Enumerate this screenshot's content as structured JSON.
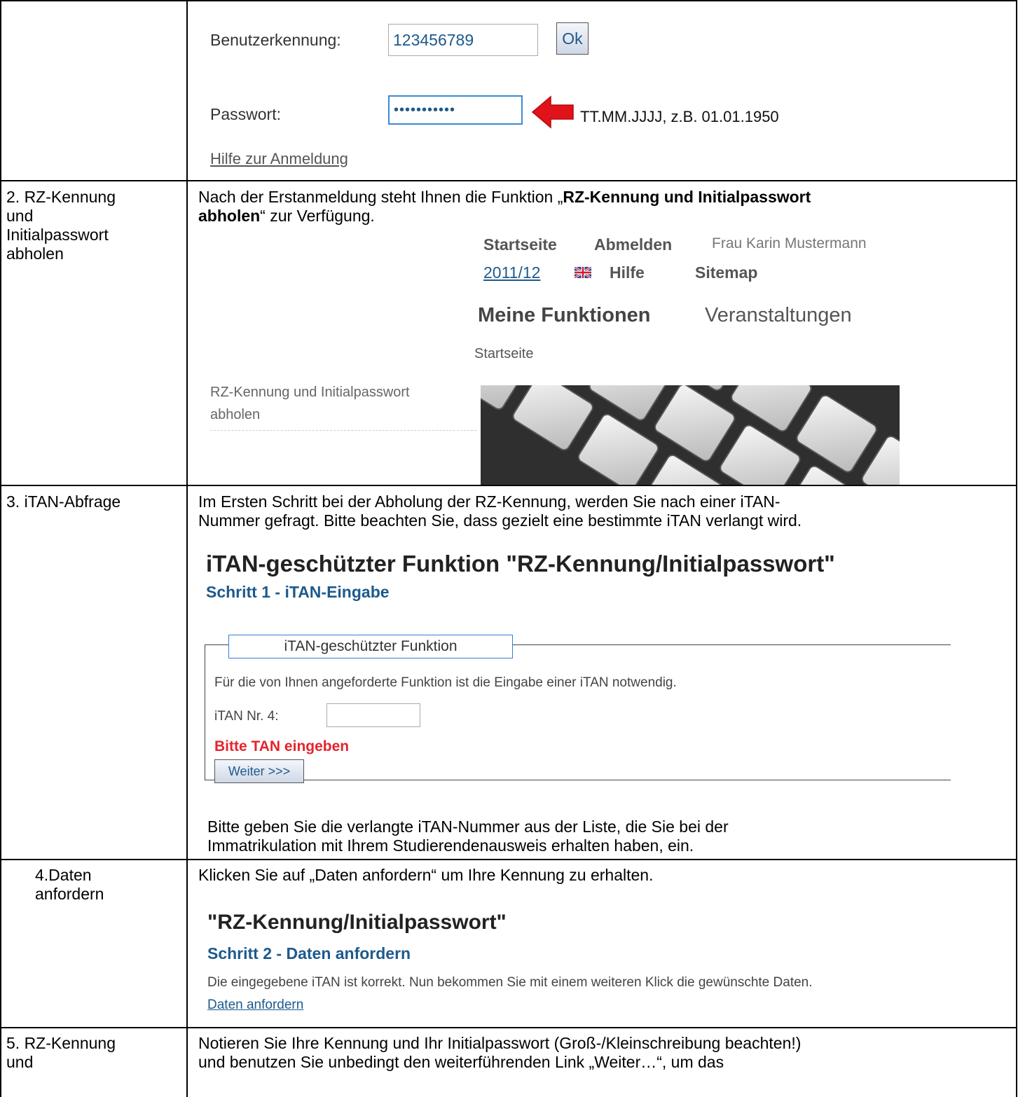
{
  "login": {
    "user_label": "Benutzerkennung:",
    "user_value": "123456789",
    "ok_label": "Ok",
    "password_label": "Passwort:",
    "password_value": "•••••••••••",
    "hint": "TT.MM.JJJJ, z.B. 01.01.1950",
    "help_link": "Hilfe zur Anmeldung"
  },
  "rows": [
    {
      "label_lines": [
        "2. RZ-Kennung",
        "und",
        "Initialpasswort",
        "abholen"
      ],
      "text_pre": "Nach der Erstanmeldung steht Ihnen die Funktion „",
      "text_bold_1": "RZ-Kennung und Initialpasswort",
      "text_bold_2": "abholen",
      "text_post": "“ zur Verfügung."
    },
    {
      "label": "3. iTAN-Abfrage",
      "text_line1": "Im Ersten Schritt bei der Abholung der RZ-Kennung, werden Sie nach einer iTAN-",
      "text_line2": "Nummer gefragt. Bitte beachten Sie, dass gezielt eine bestimmte iTAN verlangt wird.",
      "after_line1": "Bitte geben Sie die verlangte iTAN-Nummer aus der Liste, die Sie bei der",
      "after_line2": "Immatrikulation mit Ihrem Studierendenausweis erhalten haben, ein."
    },
    {
      "label_lines": [
        "4.Daten",
        "anfordern"
      ],
      "text": "Klicken Sie auf „Daten anfordern“ um Ihre Kennung zu erhalten."
    },
    {
      "label_lines": [
        "5. RZ-Kennung",
        "und"
      ],
      "text_line1": "Notieren Sie Ihre Kennung und Ihr Initialpasswort (Groß-/Kleinschreibung beachten!)",
      "text_line2": "und benutzen Sie unbedingt den weiterführenden Link „Weiter…“, um das"
    }
  ],
  "portal": {
    "nav_start": "Startseite",
    "nav_logout": "Abmelden",
    "user_name": "Frau Karin Mustermann",
    "semester": "2011/12",
    "nav_help": "Hilfe",
    "nav_sitemap": "Sitemap",
    "tab_my_functions": "Meine Funktionen",
    "tab_events": "Veranstaltungen",
    "breadcrumb": "Startseite",
    "menu_item_line1": "RZ-Kennung und Initialpasswort",
    "menu_item_line2": "abholen"
  },
  "itan": {
    "title": "iTAN-geschützter Funktion \"RZ-Kennung/Initialpasswort\"",
    "step": "Schritt 1 - iTAN-Eingabe",
    "fieldset_legend": "iTAN-geschützter Funktion",
    "info": "Für die von Ihnen angeforderte Funktion ist die Eingabe einer iTAN notwendig.",
    "field_label": "iTAN Nr. 4:",
    "error": "Bitte TAN eingeben",
    "next_button": "Weiter >>>"
  },
  "data_request": {
    "title": "\"RZ-Kennung/Initialpasswort\"",
    "step": "Schritt 2 - Daten anfordern",
    "info": "Die eingegebene iTAN ist korrekt. Nun bekommen Sie mit einem weiteren Klick die gewünschte Daten.",
    "link": "Daten anfordern"
  },
  "colors": {
    "link_blue": "#1d5a8c",
    "error_red": "#e5232e",
    "arrow_red": "#e0131b"
  }
}
